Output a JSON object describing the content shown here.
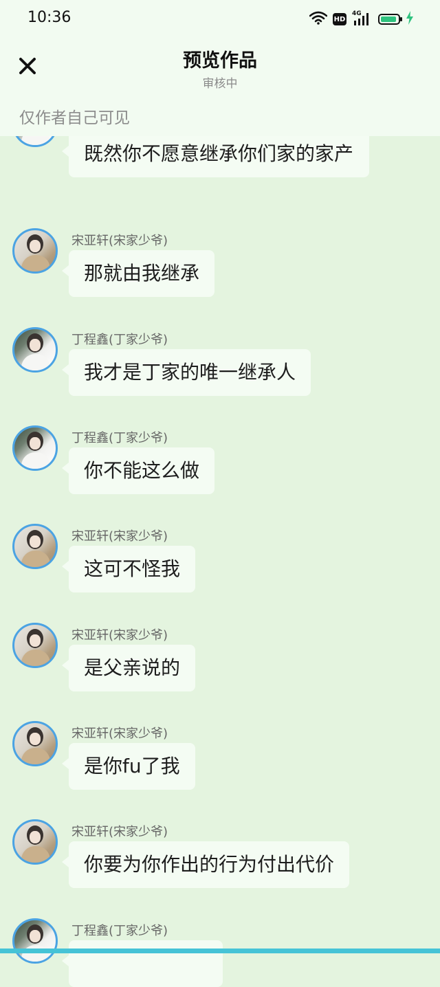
{
  "status_bar": {
    "time": "10:36",
    "network_type": "4G",
    "hd_badge": "HD",
    "battery_level": 0.9,
    "charging": true,
    "icons": [
      "wifi-icon",
      "hd-icon",
      "signal-icon",
      "battery-icon",
      "charging-bolt-icon"
    ]
  },
  "header": {
    "title": "预览作品",
    "subtitle": "审核中",
    "close_icon": "close-icon",
    "visibility_note": "仅作者自己可见"
  },
  "colors": {
    "background": "#e4f4df",
    "header_background": "#f2fbf1",
    "bubble_background": "#f4fcf3",
    "avatar_border": "#4ba3e3",
    "name_text": "#666666",
    "note_text": "#8c8c8c",
    "battery_accent": "#2ec27e",
    "bottom_accent": "#46c3d6"
  },
  "messages": [
    {
      "speaker": "",
      "text": "既然你不愿意继承你们家的家产"
    },
    {
      "speaker": "宋亚轩(宋家少爷)",
      "text": "那就由我继承"
    },
    {
      "speaker": "丁程鑫(丁家少爷)",
      "text": "我才是丁家的唯一继承人"
    },
    {
      "speaker": "丁程鑫(丁家少爷)",
      "text": "你不能这么做"
    },
    {
      "speaker": "宋亚轩(宋家少爷)",
      "text": "这可不怪我"
    },
    {
      "speaker": "宋亚轩(宋家少爷)",
      "text": "是父亲说的"
    },
    {
      "speaker": "宋亚轩(宋家少爷)",
      "text": "是你fu了我"
    },
    {
      "speaker": "宋亚轩(宋家少爷)",
      "text": "你要为你作出的行为付出代价"
    },
    {
      "speaker": "丁程鑫(丁家少爷)",
      "text": ""
    }
  ]
}
